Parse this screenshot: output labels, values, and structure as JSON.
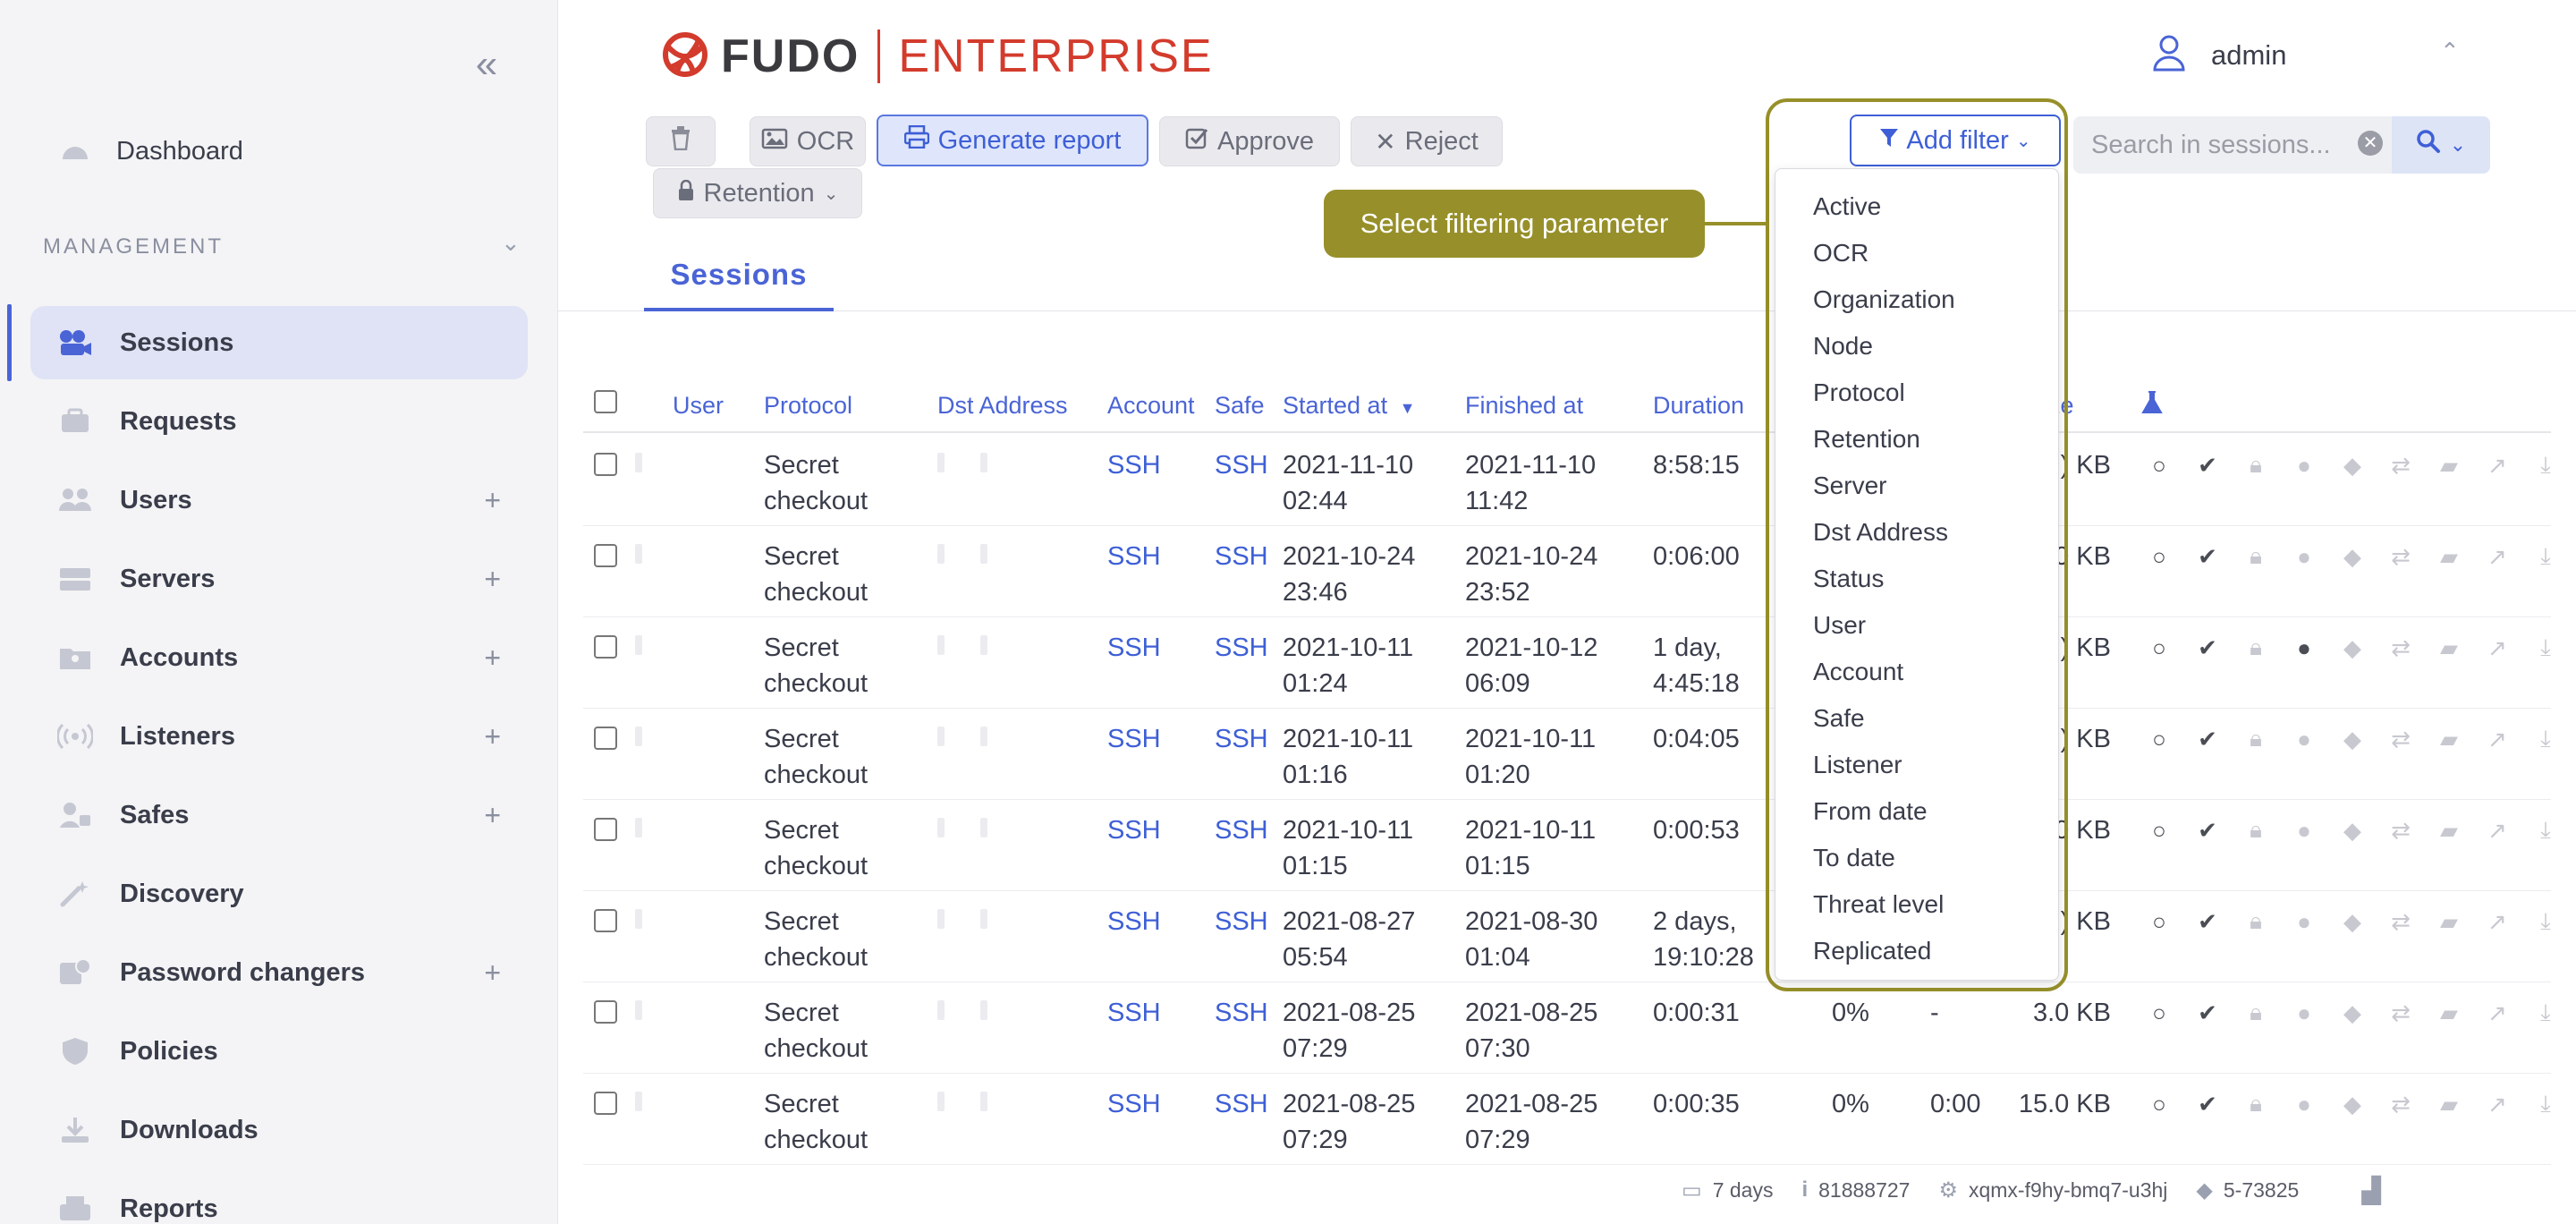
{
  "sidebar": {
    "collapse_icon": "«",
    "section_label": "MANAGEMENT",
    "items": [
      {
        "label": "Dashboard",
        "icon": "dashboard-icon",
        "plus": ""
      },
      {
        "label": "Sessions",
        "icon": "sessions-icon",
        "plus": "",
        "active": true
      },
      {
        "label": "Requests",
        "icon": "requests-icon",
        "plus": ""
      },
      {
        "label": "Users",
        "icon": "users-icon",
        "plus": "+"
      },
      {
        "label": "Servers",
        "icon": "servers-icon",
        "plus": "+"
      },
      {
        "label": "Accounts",
        "icon": "accounts-icon",
        "plus": "+"
      },
      {
        "label": "Listeners",
        "icon": "listeners-icon",
        "plus": "+"
      },
      {
        "label": "Safes",
        "icon": "safes-icon",
        "plus": "+"
      },
      {
        "label": "Discovery",
        "icon": "discovery-icon",
        "plus": ""
      },
      {
        "label": "Password changers",
        "icon": "password-changers-icon",
        "plus": "+"
      },
      {
        "label": "Policies",
        "icon": "policies-icon",
        "plus": ""
      },
      {
        "label": "Downloads",
        "icon": "downloads-icon",
        "plus": ""
      },
      {
        "label": "Reports",
        "icon": "reports-icon",
        "plus": ""
      }
    ]
  },
  "header": {
    "logo_fudo": "FUDO",
    "logo_enterprise": "ENTERPRISE",
    "user_name": "admin"
  },
  "toolbar": {
    "ocr_label": "OCR",
    "generate_report_label": "Generate report",
    "approve_label": "Approve",
    "reject_label": "Reject",
    "retention_label": "Retention",
    "add_filter_label": "Add filter",
    "search_placeholder": "Search in sessions..."
  },
  "tabs": {
    "sessions": "Sessions"
  },
  "table": {
    "headers": {
      "user": "User",
      "protocol": "Protocol",
      "dst_address": "Dst Address",
      "account": "Account",
      "safe": "Safe",
      "started_at": "Started at",
      "finished_at": "Finished at",
      "duration": "Duration",
      "size": "ze"
    },
    "rows": [
      {
        "protocol": [
          "Secret",
          "checkout"
        ],
        "account": "SSH",
        "safe": "SSH",
        "started": [
          "2021-11-10",
          "02:44"
        ],
        "finished": [
          "2021-11-10",
          "11:42"
        ],
        "duration": [
          "8:58:15",
          ""
        ],
        "pct": "",
        "extra": "",
        "size": ") KB",
        "comment_dark": false
      },
      {
        "protocol": [
          "Secret",
          "checkout"
        ],
        "account": "SSH",
        "safe": "SSH",
        "started": [
          "2021-10-24",
          "23:46"
        ],
        "finished": [
          "2021-10-24",
          "23:52"
        ],
        "duration": [
          "0:06:00",
          ""
        ],
        "pct": "",
        "extra": "",
        "size": "5.0 KB",
        "comment_dark": false
      },
      {
        "protocol": [
          "Secret",
          "checkout"
        ],
        "account": "SSH",
        "safe": "SSH",
        "started": [
          "2021-10-11",
          "01:24"
        ],
        "finished": [
          "2021-10-12",
          "06:09"
        ],
        "duration": [
          "1 day,",
          "4:45:18"
        ],
        "pct": "",
        "extra": "",
        "size": ") KB",
        "comment_dark": true
      },
      {
        "protocol": [
          "Secret",
          "checkout"
        ],
        "account": "SSH",
        "safe": "SSH",
        "started": [
          "2021-10-11",
          "01:16"
        ],
        "finished": [
          "2021-10-11",
          "01:20"
        ],
        "duration": [
          "0:04:05",
          ""
        ],
        "pct": "",
        "extra": "",
        "size": ") KB",
        "comment_dark": false
      },
      {
        "protocol": [
          "Secret",
          "checkout"
        ],
        "account": "SSH",
        "safe": "SSH",
        "started": [
          "2021-10-11",
          "01:15"
        ],
        "finished": [
          "2021-10-11",
          "01:15"
        ],
        "duration": [
          "0:00:53",
          ""
        ],
        "pct": "",
        "extra": "",
        "size": "5.0 KB",
        "comment_dark": false
      },
      {
        "protocol": [
          "Secret",
          "checkout"
        ],
        "account": "SSH",
        "safe": "SSH",
        "started": [
          "2021-08-27",
          "05:54"
        ],
        "finished": [
          "2021-08-30",
          "01:04"
        ],
        "duration": [
          "2 days,",
          "19:10:28"
        ],
        "pct": "",
        "extra": "",
        "size": ") KB",
        "comment_dark": false
      },
      {
        "protocol": [
          "Secret",
          "checkout"
        ],
        "account": "SSH",
        "safe": "SSH",
        "started": [
          "2021-08-25",
          "07:29"
        ],
        "finished": [
          "2021-08-25",
          "07:30"
        ],
        "duration": [
          "0:00:31",
          ""
        ],
        "pct": "0%",
        "extra": "-",
        "size": "3.0 KB",
        "comment_dark": false
      },
      {
        "protocol": [
          "Secret",
          "checkout"
        ],
        "account": "SSH",
        "safe": "SSH",
        "started": [
          "2021-08-25",
          "07:29"
        ],
        "finished": [
          "2021-08-25",
          "07:29"
        ],
        "duration": [
          "0:00:35",
          ""
        ],
        "pct": "0%",
        "extra": "0:00",
        "size": "15.0 KB",
        "comment_dark": false
      }
    ]
  },
  "filter_menu": {
    "tooltip": "Select filtering parameter",
    "items": [
      "Active",
      "OCR",
      "Organization",
      "Node",
      "Protocol",
      "Retention",
      "Server",
      "Dst Address",
      "Status",
      "User",
      "Account",
      "Safe",
      "Listener",
      "From date",
      "To date",
      "Threat level",
      "Replicated"
    ]
  },
  "footer": {
    "retention": "7 days",
    "id": "81888727",
    "key": "xqmx-f9hy-bmq7-u3hj",
    "version": "5-73825"
  },
  "colors": {
    "accent": "#4a64d6",
    "highlight": "#97902a",
    "brand_red": "#d33b2c"
  }
}
